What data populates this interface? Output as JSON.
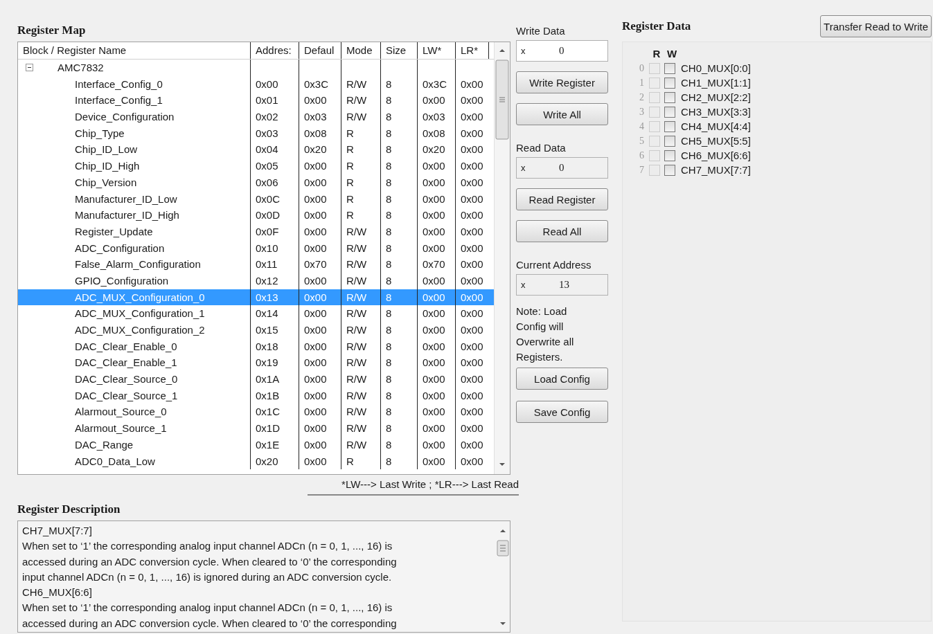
{
  "register_map": {
    "title": "Register Map",
    "columns": [
      "Block / Register Name",
      "Addres:",
      "Defaul",
      "Mode",
      "Size",
      "LW*",
      "LR*"
    ],
    "tree": {
      "label": "AMC7832",
      "expanded": true,
      "children": [
        {
          "name": "Interface_Config_0",
          "address": "0x00",
          "default": "0x3C",
          "mode": "R/W",
          "size": "8",
          "lw": "0x3C",
          "lr": "0x00",
          "selected": false
        },
        {
          "name": "Interface_Config_1",
          "address": "0x01",
          "default": "0x00",
          "mode": "R/W",
          "size": "8",
          "lw": "0x00",
          "lr": "0x00",
          "selected": false
        },
        {
          "name": "Device_Configuration",
          "address": "0x02",
          "default": "0x03",
          "mode": "R/W",
          "size": "8",
          "lw": "0x03",
          "lr": "0x00",
          "selected": false
        },
        {
          "name": "Chip_Type",
          "address": "0x03",
          "default": "0x08",
          "mode": "R",
          "size": "8",
          "lw": "0x08",
          "lr": "0x00",
          "selected": false
        },
        {
          "name": "Chip_ID_Low",
          "address": "0x04",
          "default": "0x20",
          "mode": "R",
          "size": "8",
          "lw": "0x20",
          "lr": "0x00",
          "selected": false
        },
        {
          "name": "Chip_ID_High",
          "address": "0x05",
          "default": "0x00",
          "mode": "R",
          "size": "8",
          "lw": "0x00",
          "lr": "0x00",
          "selected": false
        },
        {
          "name": "Chip_Version",
          "address": "0x06",
          "default": "0x00",
          "mode": "R",
          "size": "8",
          "lw": "0x00",
          "lr": "0x00",
          "selected": false
        },
        {
          "name": "Manufacturer_ID_Low",
          "address": "0x0C",
          "default": "0x00",
          "mode": "R",
          "size": "8",
          "lw": "0x00",
          "lr": "0x00",
          "selected": false
        },
        {
          "name": "Manufacturer_ID_High",
          "address": "0x0D",
          "default": "0x00",
          "mode": "R",
          "size": "8",
          "lw": "0x00",
          "lr": "0x00",
          "selected": false
        },
        {
          "name": "Register_Update",
          "address": "0x0F",
          "default": "0x00",
          "mode": "R/W",
          "size": "8",
          "lw": "0x00",
          "lr": "0x00",
          "selected": false
        },
        {
          "name": "ADC_Configuration",
          "address": "0x10",
          "default": "0x00",
          "mode": "R/W",
          "size": "8",
          "lw": "0x00",
          "lr": "0x00",
          "selected": false
        },
        {
          "name": "False_Alarm_Configuration",
          "address": "0x11",
          "default": "0x70",
          "mode": "R/W",
          "size": "8",
          "lw": "0x70",
          "lr": "0x00",
          "selected": false
        },
        {
          "name": "GPIO_Configuration",
          "address": "0x12",
          "default": "0x00",
          "mode": "R/W",
          "size": "8",
          "lw": "0x00",
          "lr": "0x00",
          "selected": false
        },
        {
          "name": "ADC_MUX_Configuration_0",
          "address": "0x13",
          "default": "0x00",
          "mode": "R/W",
          "size": "8",
          "lw": "0x00",
          "lr": "0x00",
          "selected": true
        },
        {
          "name": "ADC_MUX_Configuration_1",
          "address": "0x14",
          "default": "0x00",
          "mode": "R/W",
          "size": "8",
          "lw": "0x00",
          "lr": "0x00",
          "selected": false
        },
        {
          "name": "ADC_MUX_Configuration_2",
          "address": "0x15",
          "default": "0x00",
          "mode": "R/W",
          "size": "8",
          "lw": "0x00",
          "lr": "0x00",
          "selected": false
        },
        {
          "name": "DAC_Clear_Enable_0",
          "address": "0x18",
          "default": "0x00",
          "mode": "R/W",
          "size": "8",
          "lw": "0x00",
          "lr": "0x00",
          "selected": false
        },
        {
          "name": "DAC_Clear_Enable_1",
          "address": "0x19",
          "default": "0x00",
          "mode": "R/W",
          "size": "8",
          "lw": "0x00",
          "lr": "0x00",
          "selected": false
        },
        {
          "name": "DAC_Clear_Source_0",
          "address": "0x1A",
          "default": "0x00",
          "mode": "R/W",
          "size": "8",
          "lw": "0x00",
          "lr": "0x00",
          "selected": false
        },
        {
          "name": "DAC_Clear_Source_1",
          "address": "0x1B",
          "default": "0x00",
          "mode": "R/W",
          "size": "8",
          "lw": "0x00",
          "lr": "0x00",
          "selected": false
        },
        {
          "name": "Alarmout_Source_0",
          "address": "0x1C",
          "default": "0x00",
          "mode": "R/W",
          "size": "8",
          "lw": "0x00",
          "lr": "0x00",
          "selected": false
        },
        {
          "name": "Alarmout_Source_1",
          "address": "0x1D",
          "default": "0x00",
          "mode": "R/W",
          "size": "8",
          "lw": "0x00",
          "lr": "0x00",
          "selected": false
        },
        {
          "name": "DAC_Range",
          "address": "0x1E",
          "default": "0x00",
          "mode": "R/W",
          "size": "8",
          "lw": "0x00",
          "lr": "0x00",
          "selected": false
        },
        {
          "name": "ADC0_Data_Low",
          "address": "0x20",
          "default": "0x00",
          "mode": "R",
          "size": "8",
          "lw": "0x00",
          "lr": "0x00",
          "selected": false
        }
      ]
    },
    "footnote": "*LW---> Last Write ; *LR---> Last Read"
  },
  "controls": {
    "write_data": {
      "label": "Write Data",
      "prefix": "x",
      "value": "0",
      "readonly": false
    },
    "write_buttons": [
      "Write Register",
      "Write All"
    ],
    "read_data": {
      "label": "Read Data",
      "prefix": "x",
      "value": "0",
      "readonly": true
    },
    "read_buttons": [
      "Read Register",
      "Read All"
    ],
    "current_address": {
      "label": "Current Address",
      "prefix": "x",
      "value": "13",
      "readonly": true
    },
    "note": "Note: Load Config will Overwrite all Registers.",
    "config_buttons": [
      "Load Config",
      "Save Config"
    ]
  },
  "register_data": {
    "title": "Register Data",
    "transfer_button": "Transfer Read to Write",
    "read_header": "R",
    "write_header": "W",
    "bits": [
      {
        "index": "0",
        "label": "CH0_MUX[0:0]",
        "read_checked": false,
        "read_disabled": true,
        "write_checked": false
      },
      {
        "index": "1",
        "label": "CH1_MUX[1:1]",
        "read_checked": false,
        "read_disabled": true,
        "write_checked": false
      },
      {
        "index": "2",
        "label": "CH2_MUX[2:2]",
        "read_checked": false,
        "read_disabled": true,
        "write_checked": false
      },
      {
        "index": "3",
        "label": "CH3_MUX[3:3]",
        "read_checked": false,
        "read_disabled": true,
        "write_checked": false
      },
      {
        "index": "4",
        "label": "CH4_MUX[4:4]",
        "read_checked": false,
        "read_disabled": true,
        "write_checked": false
      },
      {
        "index": "5",
        "label": "CH5_MUX[5:5]",
        "read_checked": false,
        "read_disabled": true,
        "write_checked": false
      },
      {
        "index": "6",
        "label": "CH6_MUX[6:6]",
        "read_checked": false,
        "read_disabled": true,
        "write_checked": false
      },
      {
        "index": "7",
        "label": "CH7_MUX[7:7]",
        "read_checked": false,
        "read_disabled": true,
        "write_checked": false
      }
    ]
  },
  "register_description": {
    "title": "Register Description",
    "lines": [
      "CH7_MUX[7:7]",
      "When set to ‘1’ the corresponding analog input channel ADCn (n = 0, 1, ..., 16) is",
      "accessed during an ADC conversion cycle. When cleared to ‘0’ the corresponding",
      "input channel ADCn (n = 0, 1, ..., 16) is ignored during an ADC conversion cycle.",
      "CH6_MUX[6:6]",
      "When set to ‘1’ the corresponding analog input channel ADCn (n = 0, 1, ..., 16) is",
      "accessed during an ADC conversion cycle. When cleared to ‘0’ the corresponding"
    ]
  }
}
